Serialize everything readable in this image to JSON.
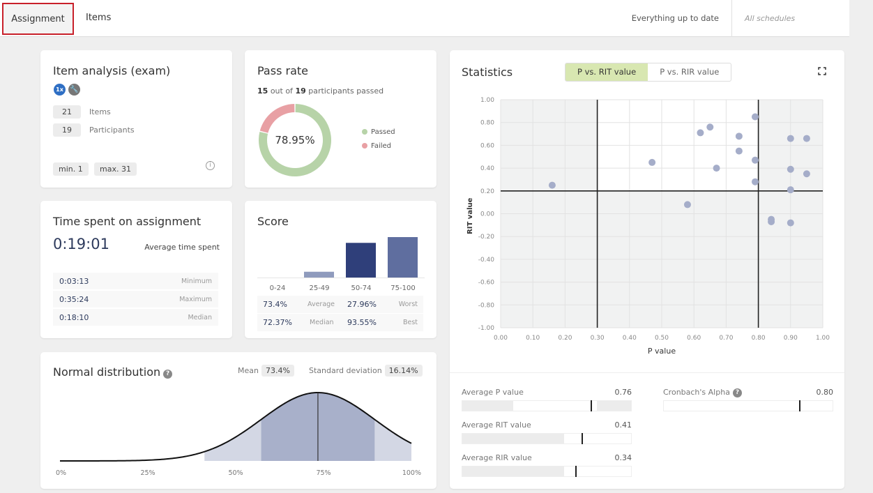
{
  "topbar": {
    "tabs": [
      {
        "label": "Assignment",
        "active": true
      },
      {
        "label": "Items",
        "active": false
      }
    ],
    "status": "Everything up to date",
    "schedules": "All schedules"
  },
  "item_analysis": {
    "title": "Item analysis (exam)",
    "badge_attempts": "1x",
    "stats": [
      {
        "value": "21",
        "label": "Items"
      },
      {
        "value": "19",
        "label": "Participants"
      }
    ],
    "min": "min. 1",
    "max": "max. 31",
    "info_icon": "i"
  },
  "pass_rate": {
    "title": "Pass rate",
    "passed_count": "15",
    "total_count": "19",
    "out_of_text": "out of",
    "suffix_text": "participants passed",
    "percentage": "78.95%",
    "passed_fraction": 0.7895,
    "legend": [
      {
        "label": "Passed",
        "color": "#b7d3a8"
      },
      {
        "label": "Failed",
        "color": "#e8a0a4"
      }
    ]
  },
  "time_spent": {
    "title": "Time spent on assignment",
    "average": "0:19:01",
    "average_label": "Average time spent",
    "rows": [
      {
        "value": "0:03:13",
        "label": "Minimum"
      },
      {
        "value": "0:35:24",
        "label": "Maximum"
      },
      {
        "value": "0:18:10",
        "label": "Median"
      }
    ]
  },
  "score": {
    "title": "Score",
    "stats": [
      [
        {
          "value": "73.4%",
          "label": "Average"
        },
        {
          "value": "27.96%",
          "label": "Worst"
        }
      ],
      [
        {
          "value": "72.37%",
          "label": "Median"
        },
        {
          "value": "93.55%",
          "label": "Best"
        }
      ]
    ]
  },
  "normal_distribution": {
    "title": "Normal distribution",
    "help_icon": "?",
    "mean_label": "Mean",
    "mean_value": "73.4%",
    "sd_label": "Standard deviation",
    "sd_value": "16.14%"
  },
  "statistics": {
    "title": "Statistics",
    "toggle": [
      {
        "label": "P vs. RIT value",
        "active": true
      },
      {
        "label": "P vs. RIR value",
        "active": false
      }
    ],
    "metrics": [
      {
        "label": "Average P value",
        "value": "0.76",
        "position": 0.76,
        "range": [
          0.3,
          0.8
        ]
      },
      {
        "label": "Average RIT value",
        "value": "0.41",
        "position": 0.41,
        "fill_to": 0.2
      },
      {
        "label": "Average RIR value",
        "value": "0.34",
        "position": 0.34,
        "fill_to": 0.2
      }
    ],
    "cronbach": {
      "label": "Cronbach's Alpha",
      "value": "0.80",
      "position": 0.8,
      "help_icon": "?"
    }
  },
  "chart_data": [
    {
      "type": "pie",
      "title": "Pass rate",
      "categories": [
        "Passed",
        "Failed"
      ],
      "values": [
        15,
        4
      ],
      "center_label": "78.95%",
      "colors": [
        "#b7d3a8",
        "#e8a0a4"
      ]
    },
    {
      "type": "bar",
      "title": "Score",
      "categories": [
        "0-24",
        "25-49",
        "50-74",
        "75-100"
      ],
      "values": [
        0,
        1,
        6,
        7
      ],
      "colors": [
        "#8f9bbd",
        "#8f9bbd",
        "#2f3f7a",
        "#5f6e9f"
      ]
    },
    {
      "type": "area",
      "title": "Normal distribution",
      "mean": 73.4,
      "sd": 16.14,
      "xlim": [
        0,
        100
      ],
      "x_ticks": [
        "0%",
        "25%",
        "50%",
        "75%",
        "100%"
      ],
      "bands": {
        "outer_sd": 2,
        "inner_sd": 1
      }
    },
    {
      "type": "scatter",
      "title": "P vs. RIT value",
      "xlabel": "P value",
      "ylabel": "RIT value",
      "xlim": [
        0,
        1
      ],
      "ylim": [
        -1,
        1
      ],
      "x_ticks": [
        "0.00",
        "0.10",
        "0.20",
        "0.30",
        "0.40",
        "0.50",
        "0.60",
        "0.70",
        "0.80",
        "0.90",
        "1.00"
      ],
      "y_ticks": [
        "1.00",
        "0.80",
        "0.60",
        "0.40",
        "0.20",
        "0.00",
        "-0.20",
        "-0.40",
        "-0.60",
        "-0.80",
        "-1.00"
      ],
      "thresholds": {
        "x": [
          0.3,
          0.8
        ],
        "y": [
          0.2
        ]
      },
      "grid": true,
      "points": [
        [
          0.16,
          0.25
        ],
        [
          0.47,
          0.45
        ],
        [
          0.62,
          0.71
        ],
        [
          0.65,
          0.76
        ],
        [
          0.74,
          0.68
        ],
        [
          0.74,
          0.55
        ],
        [
          0.67,
          0.4
        ],
        [
          0.58,
          0.08
        ],
        [
          0.79,
          0.85
        ],
        [
          0.79,
          0.47
        ],
        [
          0.79,
          0.28
        ],
        [
          0.9,
          0.66
        ],
        [
          0.95,
          0.66
        ],
        [
          0.9,
          0.39
        ],
        [
          0.95,
          0.35
        ],
        [
          0.9,
          0.21
        ],
        [
          0.84,
          -0.05
        ],
        [
          0.84,
          -0.07
        ],
        [
          0.9,
          -0.08
        ]
      ],
      "point_color": "#a5adc9"
    }
  ]
}
